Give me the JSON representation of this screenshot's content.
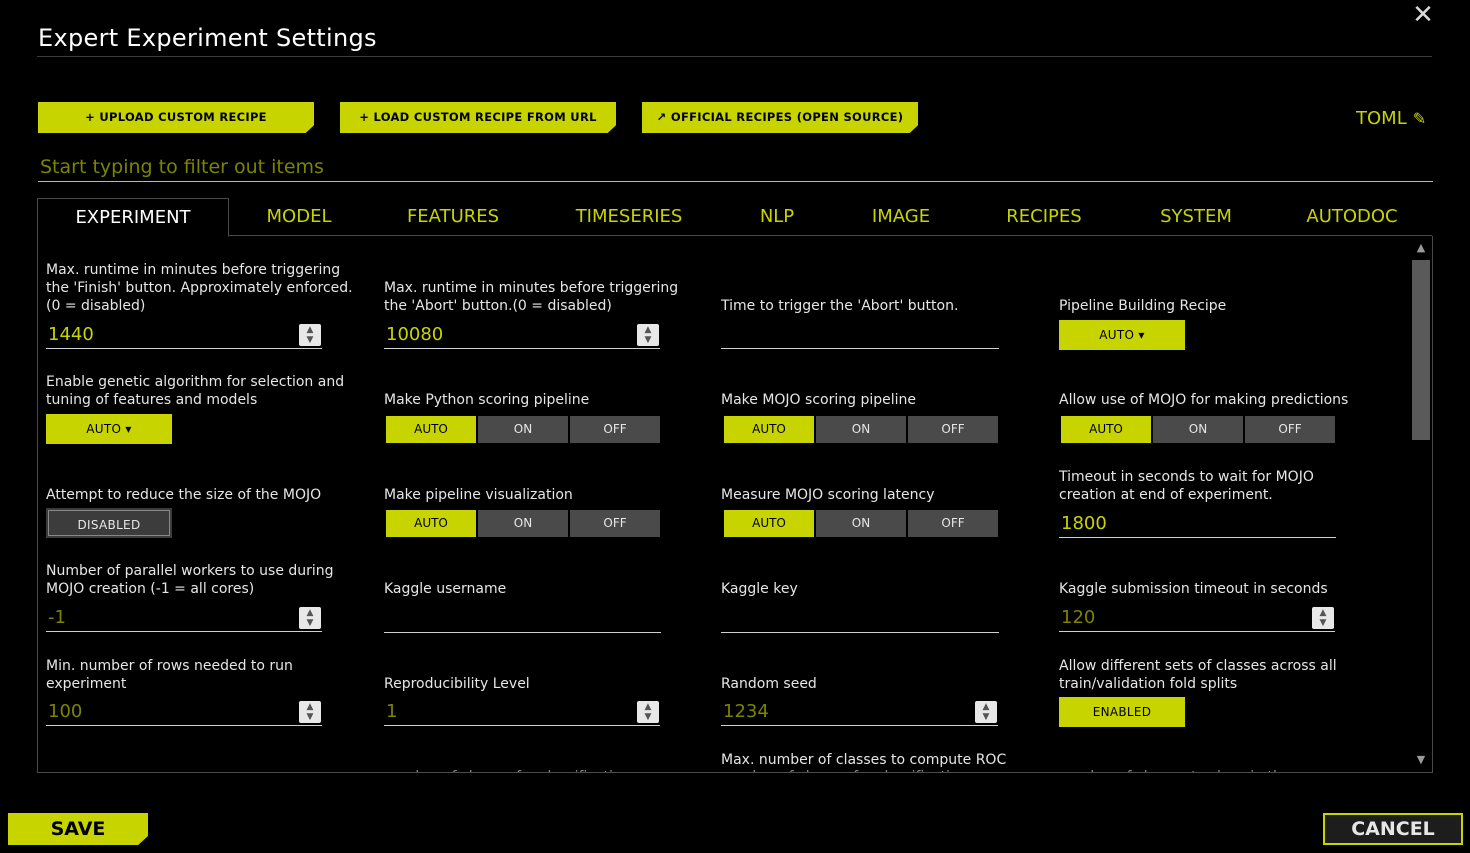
{
  "dialog": {
    "title": "Expert Experiment Settings",
    "close_glyph": "✕"
  },
  "toolbar": {
    "upload": "+ UPLOAD CUSTOM RECIPE",
    "load_url": "+ LOAD CUSTOM RECIPE FROM URL",
    "official": "↗ OFFICIAL RECIPES (OPEN SOURCE)",
    "toml": "TOML",
    "pencil_glyph": "✎"
  },
  "filter": {
    "placeholder": "Start typing to filter out items",
    "value": ""
  },
  "tabs": [
    "EXPERIMENT",
    "MODEL",
    "FEATURES",
    "TIMESERIES",
    "NLP",
    "IMAGE",
    "RECIPES",
    "SYSTEM",
    "AUTODOC"
  ],
  "active_tab": "EXPERIMENT",
  "settings": {
    "finish_runtime": {
      "label": "Max. runtime in minutes before triggering the 'Finish' button. Approximately enforced. (0 = disabled)",
      "value": "1440"
    },
    "abort_runtime": {
      "label": "Max. runtime in minutes before triggering the 'Abort' button.(0 = disabled)",
      "value": "10080"
    },
    "abort_time": {
      "label": "Time to trigger the 'Abort' button.",
      "value": ""
    },
    "pipeline_recipe": {
      "label": "Pipeline Building Recipe",
      "value": "AUTO ▾"
    },
    "genetic_algo": {
      "label": "Enable genetic algorithm for selection and tuning of features and models",
      "value": "AUTO ▾"
    },
    "python_pipeline": {
      "label": "Make Python scoring pipeline",
      "options": [
        "AUTO",
        "ON",
        "OFF"
      ],
      "selected": "AUTO"
    },
    "mojo_pipeline": {
      "label": "Make MOJO scoring pipeline",
      "options": [
        "AUTO",
        "ON",
        "OFF"
      ],
      "selected": "AUTO"
    },
    "mojo_predictions": {
      "label": "Allow use of MOJO for making predictions",
      "options": [
        "AUTO",
        "ON",
        "OFF"
      ],
      "selected": "AUTO"
    },
    "reduce_mojo": {
      "label": "Attempt to reduce the size of the MOJO",
      "value": "DISABLED"
    },
    "pipeline_viz": {
      "label": "Make pipeline visualization",
      "options": [
        "AUTO",
        "ON",
        "OFF"
      ],
      "selected": "AUTO"
    },
    "mojo_latency": {
      "label": "Measure MOJO scoring latency",
      "options": [
        "AUTO",
        "ON",
        "OFF"
      ],
      "selected": "AUTO"
    },
    "mojo_timeout": {
      "label": "Timeout in seconds to wait for MOJO creation at end of experiment.",
      "value": "1800"
    },
    "parallel_workers": {
      "label": "Number of parallel workers to use during MOJO creation (-1 = all cores)",
      "value": "-1"
    },
    "kaggle_username": {
      "label": "Kaggle username",
      "value": ""
    },
    "kaggle_key": {
      "label": "Kaggle key",
      "value": ""
    },
    "kaggle_timeout": {
      "label": "Kaggle submission timeout in seconds",
      "value": "120"
    },
    "min_rows": {
      "label": "Min. number of rows needed to run experiment",
      "value": "100"
    },
    "reproducibility": {
      "label": "Reproducibility Level",
      "value": "1"
    },
    "random_seed": {
      "label": "Random seed",
      "value": "1234"
    },
    "fold_classes": {
      "label": "Allow different sets of classes across all train/validation fold splits",
      "value": "ENABLED"
    },
    "roc_classes": {
      "label": "Max. number of classes to compute ROC"
    }
  },
  "cut_off_text": {
    "col2": "number of classes for classification",
    "col3": "number of classes for classification",
    "col4": "number of classes to show in the confusion"
  },
  "footer": {
    "save": "SAVE",
    "cancel": "CANCEL"
  },
  "colors": {
    "accent": "#c8d400",
    "background": "#000000",
    "toggle_off": "#4a4a4a"
  }
}
